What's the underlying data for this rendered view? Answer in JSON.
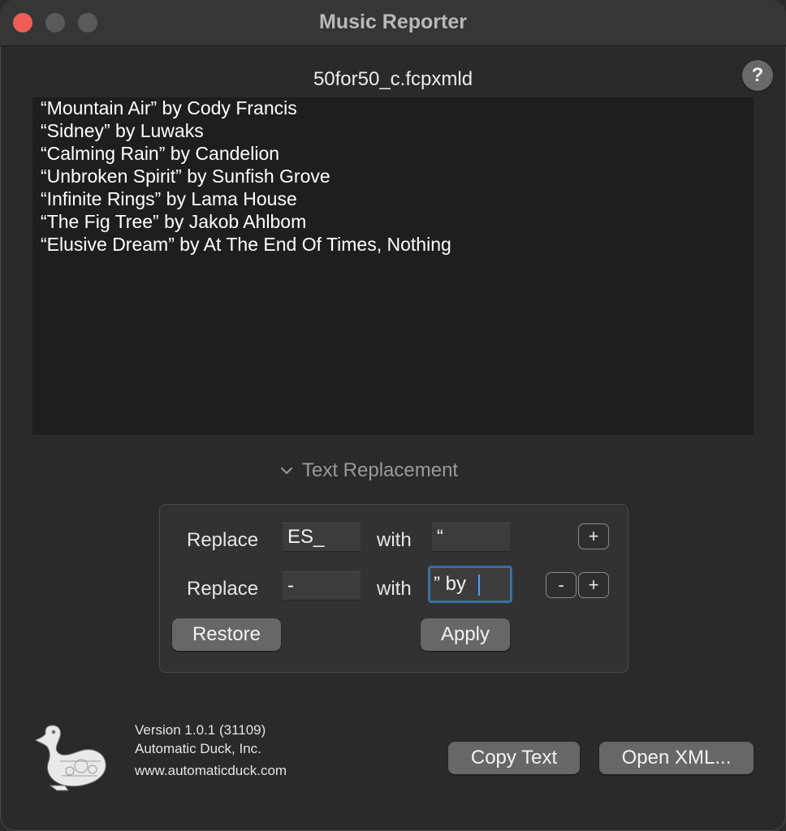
{
  "window": {
    "title": "Music Reporter"
  },
  "header": {
    "filename": "50for50_c.fcpxmld",
    "help_label": "?"
  },
  "report": {
    "lines": [
      "“Mountain Air” by Cody Francis",
      "“Sidney” by Luwaks",
      "“Calming Rain” by Candelion",
      "“Unbroken Spirit” by Sunfish Grove",
      "“Infinite Rings” by Lama House",
      "“The Fig Tree” by Jakob Ahlbom",
      "“Elusive Dream” by At The End Of Times, Nothing"
    ]
  },
  "replacement": {
    "section_label": "Text Replacement",
    "rows": [
      {
        "replace_label": "Replace",
        "find_value": "ES_",
        "with_label": "with",
        "replace_value": "“"
      },
      {
        "replace_label": "Replace",
        "find_value": "-",
        "with_label": "with",
        "replace_value": "” by "
      }
    ],
    "add_label": "+",
    "remove_label": "-",
    "restore_label": "Restore",
    "apply_label": "Apply"
  },
  "footer": {
    "version": "Version 1.0.1 (31109)",
    "company": "Automatic Duck, Inc.",
    "website": "www.automaticduck.com",
    "copy_label": "Copy Text",
    "open_label": "Open XML..."
  },
  "icons": {
    "help": "question-icon",
    "disclosure": "chevron-down-icon",
    "logo": "duck-logo"
  },
  "colors": {
    "close": "#ee5e57",
    "focus_ring": "#3b6fa1",
    "caret": "#4c9aff"
  }
}
